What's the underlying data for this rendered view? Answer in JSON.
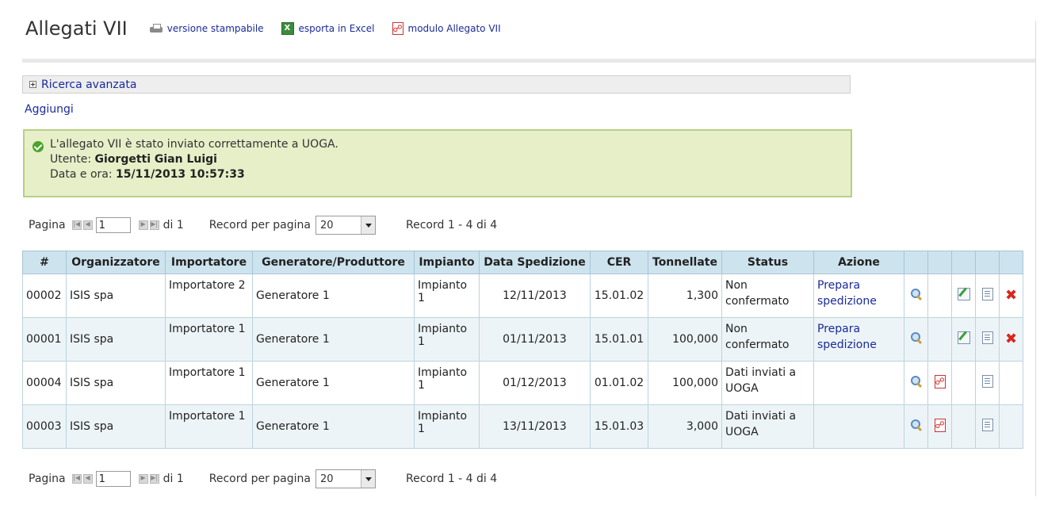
{
  "page": {
    "title": "Allegati VII",
    "links": [
      {
        "label": "versione stampabile",
        "icon": "printer-icon"
      },
      {
        "label": "esporta in Excel",
        "icon": "excel-icon"
      },
      {
        "label": "modulo Allegato VII",
        "icon": "pdf-icon"
      }
    ]
  },
  "search": {
    "label": "Ricerca avanzata",
    "icon": "expand-plus-icon"
  },
  "add_link": "Aggiungi",
  "message": {
    "icon": "success-check-icon",
    "text": "L'allegato VII è stato inviato correttamente a UOGA.",
    "user_label": "Utente:",
    "user_value": "Giorgetti Gian Luigi",
    "date_label": "Data e ora:",
    "date_value": "15/11/2013 10:57:33"
  },
  "pager": {
    "page_label": "Pagina",
    "page_value": "1",
    "of_label": "di 1",
    "per_page_label": "Record per pagina",
    "per_page_value": "20",
    "records": "Record 1 - 4 di 4"
  },
  "table": {
    "headers": [
      "#",
      "Organizzatore",
      "Importatore",
      "Generatore/Produttore",
      "Impianto",
      "Data Spedizione",
      "CER",
      "Tonnellate",
      "Status",
      "Azione"
    ],
    "rows": [
      {
        "id": "00002",
        "org": "ISIS spa",
        "imp": "Importatore 2",
        "gen": "Generatore 1",
        "impianto": "Impianto 1",
        "date": "12/11/2013",
        "cer": "15.01.02",
        "ton": "1,300",
        "status": "Non confermato",
        "action": "Prepara spedizione"
      },
      {
        "id": "00001",
        "org": "ISIS spa",
        "imp": "Importatore 1",
        "gen": "Generatore 1",
        "impianto": "Impianto 1",
        "date": "01/11/2013",
        "cer": "15.01.01",
        "ton": "100,000",
        "status": "Non confermato",
        "action": "Prepara spedizione"
      },
      {
        "id": "00004",
        "org": "ISIS spa",
        "imp": "Importatore 1",
        "gen": "Generatore 1",
        "impianto": "Impianto 1",
        "date": "01/12/2013",
        "cer": "01.01.02",
        "ton": "100,000",
        "status": "Dati inviati a UOGA",
        "action": ""
      },
      {
        "id": "00003",
        "org": "ISIS spa",
        "imp": "Importatore 1",
        "gen": "Generatore 1",
        "impianto": "Impianto 1",
        "date": "13/11/2013",
        "cer": "15.01.03",
        "ton": "3,000",
        "status": "Dati inviati a UOGA",
        "action": ""
      }
    ]
  },
  "colors": {
    "header_bg": "#cde3ee",
    "message_bg": "#e6efc8",
    "link": "#1a2a9a"
  }
}
